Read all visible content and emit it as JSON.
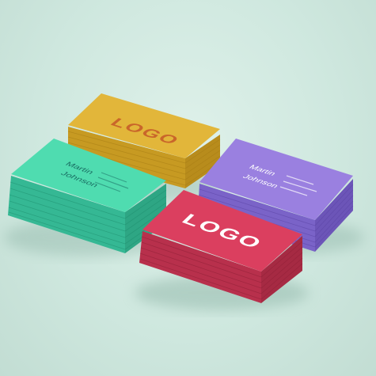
{
  "cards": {
    "yellow": {
      "logo": "LOGO",
      "color": "#e2b63a"
    },
    "green": {
      "name_first": "Martin",
      "name_last": "Johnson",
      "details": [
        "",
        "",
        ""
      ],
      "color": "#4fdcb0"
    },
    "purple": {
      "name_first": "Martin",
      "name_last": "Johnson",
      "details": [
        "",
        "",
        ""
      ],
      "color": "#9a80e0"
    },
    "red": {
      "logo": "LOGO",
      "color": "#db3f5f"
    }
  },
  "background_color": "#d6ece4"
}
